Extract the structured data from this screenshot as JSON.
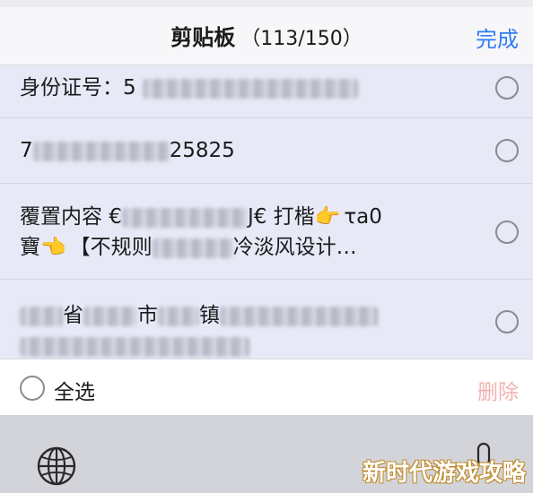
{
  "header": {
    "title": "剪贴板",
    "count": "（113/150）",
    "done_label": "完成"
  },
  "items": [
    {
      "prefix": "身份证号：5",
      "suffix": ""
    },
    {
      "prefix": "7",
      "suffix": "25825"
    },
    {
      "line1_prefix": "覆置内容 €",
      "line1_mid": "J€ 打楷",
      "line1_emoji": "👉",
      "line1_suffix": "τa0",
      "line2_prefix": "寶",
      "line2_emoji": "👈",
      "line2_mid": "【不规则",
      "line2_suffix": "冷淡风设计…"
    },
    {
      "line1_a": "省",
      "line1_b": "市",
      "line1_c": "镇"
    }
  ],
  "footer": {
    "select_all_label": "全选",
    "delete_label": "删除"
  },
  "keyboard": {
    "globe_icon": "globe-icon",
    "mic_icon": "microphone-icon"
  },
  "watermark": "新时代游戏攻略",
  "colors": {
    "accent": "#2f7cf6",
    "delete_disabled": "#f2b3b0",
    "row_bg": "#e7e9f7"
  }
}
